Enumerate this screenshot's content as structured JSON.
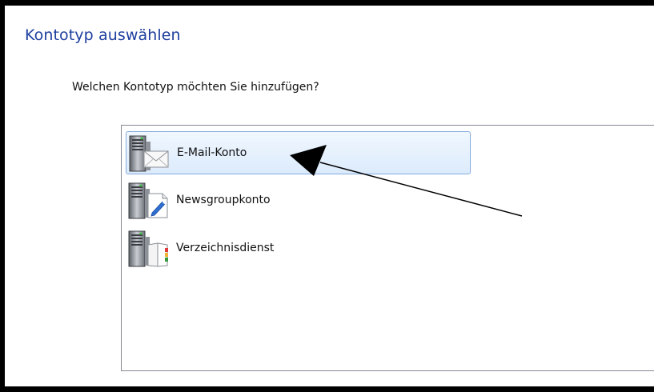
{
  "header": {
    "title": "Kontotyp auswählen"
  },
  "prompt": {
    "question": "Welchen Kontotyp möchten Sie hinzufügen?"
  },
  "account_types": {
    "selected_index": 0,
    "items": [
      {
        "label": "E-Mail-Konto",
        "icon": "server-mail-icon"
      },
      {
        "label": "Newsgroupkonto",
        "icon": "server-newsgroup-icon"
      },
      {
        "label": "Verzeichnisdienst",
        "icon": "server-directory-icon"
      }
    ]
  },
  "colors": {
    "title": "#1e3f9e",
    "selection_border": "#84acdd",
    "selection_fill": "#dcebfc",
    "listbox_border": "#828790",
    "annotation_arrow": "#000000"
  }
}
